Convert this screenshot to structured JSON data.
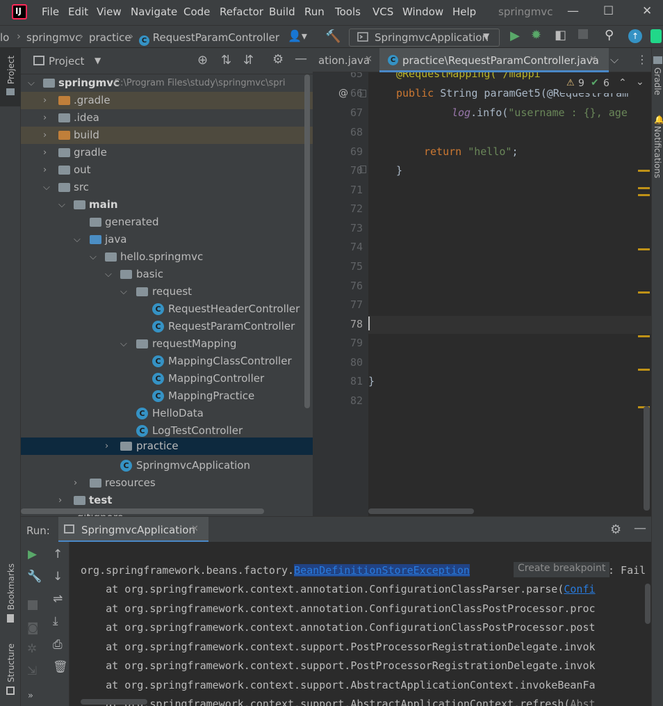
{
  "menubar": {
    "items": [
      "File",
      "Edit",
      "View",
      "Navigate",
      "Code",
      "Refactor",
      "Build",
      "Run",
      "Tools",
      "VCS",
      "Window",
      "Help"
    ],
    "window_title": "springmvc"
  },
  "navbar": {
    "crumbs": [
      "lo",
      "springmvc",
      "practice",
      "RequestParamController"
    ],
    "run_config": "SpringmvcApplication"
  },
  "project": {
    "title": "Project",
    "root_name": "springmvc",
    "root_path": "C:\\Program Files\\study\\springmvc\\spri",
    "tree": [
      "springmvc",
      ".gradle",
      ".idea",
      "build",
      "gradle",
      "out",
      "src",
      "main",
      "generated",
      "java",
      "hello.springmvc",
      "basic",
      "request",
      "RequestHeaderController",
      "RequestParamController",
      "requestMapping",
      "MappingClassController",
      "MappingController",
      "MappingPractice",
      "HelloData",
      "LogTestController",
      "practice",
      "SpringmvcApplication",
      "resources",
      "test",
      ".gitignore"
    ]
  },
  "editor": {
    "tab_prev": "ation.java",
    "tab_active": "practice\\RequestParamController.java",
    "warnings": "9",
    "checks": "6",
    "line_numbers": [
      "65",
      "66",
      "67",
      "68",
      "69",
      "70",
      "71",
      "72",
      "73",
      "74",
      "75",
      "76",
      "77",
      "78",
      "79",
      "80",
      "81",
      "82"
    ],
    "code": {
      "l65": "@RequestMapping(\"/mappi",
      "l66_kw": "public",
      "l66_rest": " String paramGet5(@RequestParam",
      "l67_fn": "log",
      "l67_mid": ".info(",
      "l67_str": "\"username : {}, age",
      "l69_kw": "return",
      "l69_str": "\"hello\"",
      "l70": "}",
      "l81": "}"
    }
  },
  "right_strip": {
    "gradle": "Gradle",
    "notifications": "Notifications"
  },
  "left_strip": {
    "project": "Project",
    "bookmarks": "Bookmarks",
    "structure": "Structure"
  },
  "run": {
    "label": "Run:",
    "tab": "SpringmvcApplication",
    "tooltip": "Create breakpoint",
    "lines": {
      "first_prefix": "org.springframework.beans.factory.",
      "first_link": "BeanDefinitionStoreException",
      "first_suffix": ": Fail",
      "l2": "    at org.springframework.context.annotation.ConfigurationClassParser.parse(",
      "l2_link": "Confi",
      "l3": "    at org.springframework.context.annotation.ConfigurationClassPostProcessor.proc",
      "l4": "    at org.springframework.context.annotation.ConfigurationClassPostProcessor.post",
      "l5": "    at org.springframework.context.support.PostProcessorRegistrationDelegate.invok",
      "l6": "    at org.springframework.context.support.PostProcessorRegistrationDelegate.invok",
      "l7": "    at org.springframework.context.support.AbstractApplicationContext.invokeBeanFa",
      "l8": "    at org.springframework.context.support.AbstractApplicationContext.refresh(",
      "l8_link": "Abst"
    }
  }
}
